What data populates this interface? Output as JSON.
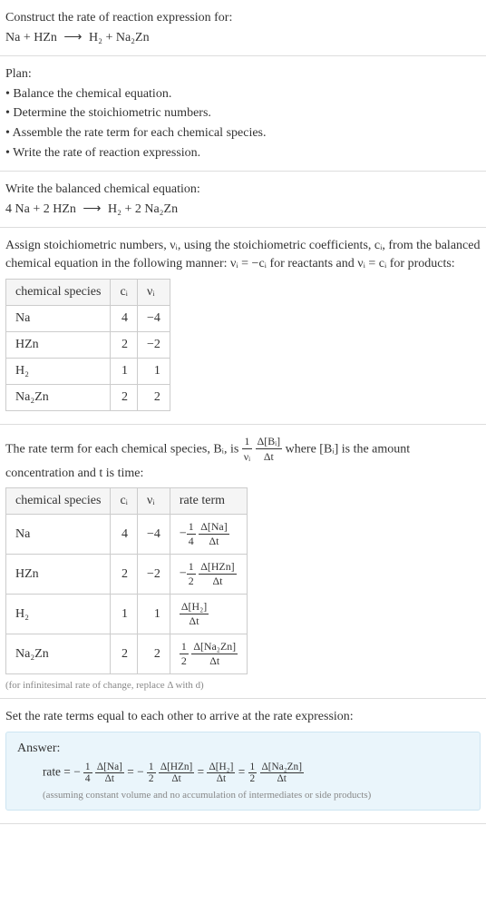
{
  "intro": {
    "title": "Construct the rate of reaction expression for:",
    "equation_left": "Na + HZn",
    "arrow": "⟶",
    "equation_right": "H₂ + Na₂Zn"
  },
  "plan": {
    "heading": "Plan:",
    "items": [
      "• Balance the chemical equation.",
      "• Determine the stoichiometric numbers.",
      "• Assemble the rate term for each chemical species.",
      "• Write the rate of reaction expression."
    ]
  },
  "balanced": {
    "heading": "Write the balanced chemical equation:",
    "equation_left": "4 Na + 2 HZn",
    "arrow": "⟶",
    "equation_right": "H₂ + 2 Na₂Zn"
  },
  "stoich": {
    "text": "Assign stoichiometric numbers, νᵢ, using the stoichiometric coefficients, cᵢ, from the balanced chemical equation in the following manner: νᵢ = −cᵢ for reactants and νᵢ = cᵢ for products:",
    "headers": {
      "species": "chemical species",
      "c": "cᵢ",
      "nu": "νᵢ"
    },
    "rows": [
      {
        "species": "Na",
        "c": "4",
        "nu": "−4"
      },
      {
        "species": "HZn",
        "c": "2",
        "nu": "−2"
      },
      {
        "species": "H₂",
        "c": "1",
        "nu": "1"
      },
      {
        "species": "Na₂Zn",
        "c": "2",
        "nu": "2"
      }
    ]
  },
  "rateterm": {
    "text_before": "The rate term for each chemical species, Bᵢ, is ",
    "frac1_num": "1",
    "frac1_den": "νᵢ",
    "frac2_num": "Δ[Bᵢ]",
    "frac2_den": "Δt",
    "text_after": " where [Bᵢ] is the amount concentration and t is time:",
    "headers": {
      "species": "chemical species",
      "c": "cᵢ",
      "nu": "νᵢ",
      "rate": "rate term"
    },
    "rows": [
      {
        "species": "Na",
        "c": "4",
        "nu": "−4",
        "sign": "−",
        "fnum": "1",
        "fden": "4",
        "dnum": "Δ[Na]",
        "dden": "Δt"
      },
      {
        "species": "HZn",
        "c": "2",
        "nu": "−2",
        "sign": "−",
        "fnum": "1",
        "fden": "2",
        "dnum": "Δ[HZn]",
        "dden": "Δt"
      },
      {
        "species": "H₂",
        "c": "1",
        "nu": "1",
        "sign": "",
        "fnum": "",
        "fden": "",
        "dnum": "Δ[H₂]",
        "dden": "Δt"
      },
      {
        "species": "Na₂Zn",
        "c": "2",
        "nu": "2",
        "sign": "",
        "fnum": "1",
        "fden": "2",
        "dnum": "Δ[Na₂Zn]",
        "dden": "Δt"
      }
    ],
    "note": "(for infinitesimal rate of change, replace Δ with d)"
  },
  "final": {
    "heading": "Set the rate terms equal to each other to arrive at the rate expression:",
    "answer_label": "Answer:",
    "expr": {
      "prefix": "rate = −",
      "t1_fnum": "1",
      "t1_fden": "4",
      "t1_dnum": "Δ[Na]",
      "t1_dden": "Δt",
      "eq1": " = −",
      "t2_fnum": "1",
      "t2_fden": "2",
      "t2_dnum": "Δ[HZn]",
      "t2_dden": "Δt",
      "eq2": " = ",
      "t3_dnum": "Δ[H₂]",
      "t3_dden": "Δt",
      "eq3": " = ",
      "t4_fnum": "1",
      "t4_fden": "2",
      "t4_dnum": "Δ[Na₂Zn]",
      "t4_dden": "Δt"
    },
    "note": "(assuming constant volume and no accumulation of intermediates or side products)"
  }
}
